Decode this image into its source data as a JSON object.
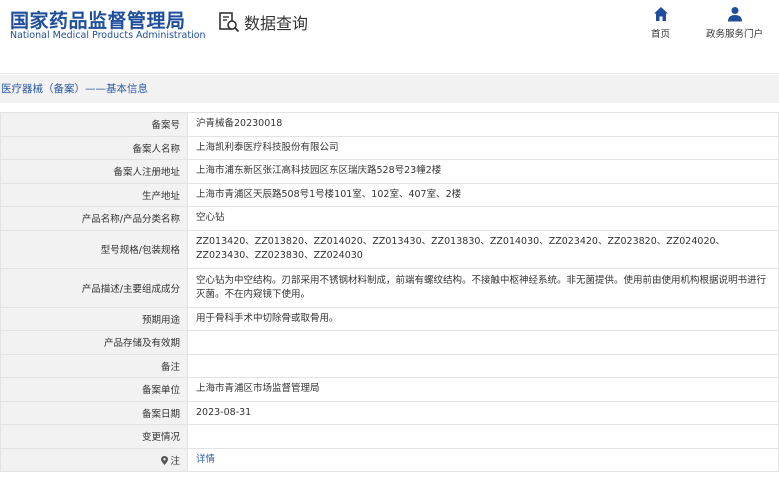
{
  "header": {
    "logo_cn": "国家药品监督管理局",
    "logo_en": "National Medical Products Administration",
    "query_label": "数据查询",
    "nav_home": "首页",
    "nav_user": "政务服务门户"
  },
  "section_title": "医疗器械（备案）——基本信息",
  "rows": [
    {
      "label": "备案号",
      "value": "沪青械备20230018"
    },
    {
      "label": "备案人名称",
      "value": "上海凯利泰医疗科技股份有限公司"
    },
    {
      "label": "备案人注册地址",
      "value": "上海市浦东新区张江高科技园区东区瑞庆路528号23幢2楼"
    },
    {
      "label": "生产地址",
      "value": "上海市青浦区天辰路508号1号楼101室、102室、407室、2楼"
    },
    {
      "label": "产品名称/产品分类名称",
      "value": "空心钻"
    },
    {
      "label": "型号规格/包装规格",
      "value": "ZZ013420、ZZ013820、ZZ014020、ZZ013430、ZZ013830、ZZ014030、ZZ023420、ZZ023820、ZZ024020、ZZ023430、ZZ023830、ZZ024030"
    },
    {
      "label": "产品描述/主要组成成分",
      "value": "空心钻为中空结构。刃部采用不锈钢材料制成，前端有螺纹结构。不接触中枢神经系统。非无菌提供。使用前由使用机构根据说明书进行灭菌。不在内窥镜下使用。"
    },
    {
      "label": "预期用途",
      "value": "用于骨科手术中切除骨或取骨用。"
    },
    {
      "label": "产品存储及有效期",
      "value": ""
    },
    {
      "label": "备注",
      "value": ""
    },
    {
      "label": "备案单位",
      "value": "上海市青浦区市场监督管理局"
    },
    {
      "label": "备案日期",
      "value": "2023-08-31"
    },
    {
      "label": "变更情况",
      "value": ""
    },
    {
      "label": "注",
      "value": "详情"
    }
  ],
  "colors": {
    "brand_blue": "#1f4f9c",
    "link_blue": "#2c5aa0",
    "label_bg": "#f2f2f2",
    "border": "#e3e3e3"
  },
  "icons": {
    "query": "search-document-icon",
    "home": "home-icon",
    "user": "user-icon",
    "note": "location-pin-icon"
  }
}
